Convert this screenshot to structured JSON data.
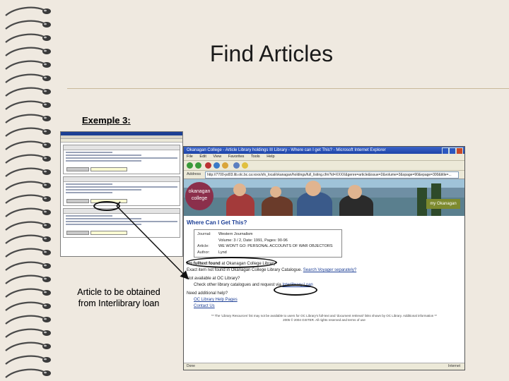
{
  "slide": {
    "title": "Find Articles",
    "example_label": "Exemple 3:",
    "note": "Article to be obtained from Interlibrary loan",
    "colors": {
      "background": "#efe9e0",
      "rule": "#c8b89a",
      "text": "#1a1a1a"
    }
  },
  "browser": {
    "window_title": "Okanagan College - Article Library holdings III Library - Where can I get This? - Microsoft Internet Explorer",
    "menu": [
      "File",
      "Edit",
      "View",
      "Favorites",
      "Tools",
      "Help"
    ],
    "address_label": "Address",
    "url": "http://7700-pd03.lib.olc.bc.ca:xxxx/sfx_local/okanagan/holdings/full_listing.cfm?id=XXXX&genre=article&issue=2&volume=3&spage=90&epage=300&title=...",
    "banner": {
      "logo_line1": "okanagan",
      "logo_line2": "college",
      "my_okanagan": "my Okanagan"
    },
    "page": {
      "heading": "Where Can I Get This?",
      "citation": [
        {
          "key": "Journal:",
          "value": "Western Journalism"
        },
        {
          "key": "",
          "value": "Volume: 3 / 2, Date: 1991, Pages: 90-96"
        },
        {
          "key": "Article:",
          "value": "WE WON'T GO: PERSONAL ACCOUNTS OF WAR OBJECTORS"
        },
        {
          "key": "Author:",
          "value": "Lynd"
        }
      ],
      "no_fulltext_prefix": "No fulltext found",
      "no_fulltext_suffix": " at Okanagan College Library",
      "exact_item_text": "Exact item not found in Okanagan College Library Catalogue.",
      "search_voyager_link": "Search Voyager separately?",
      "not_available_heading": "Not available at OC Library?",
      "check_other_prefix": "Check other library catalogues and request via ",
      "interlibrary_link": "Interlibrary Loan",
      "need_help_heading": "Need additional help?",
      "help_links": [
        "OC Library Help Pages",
        "Contact Us"
      ],
      "footer_line1": "** The 'Library Resources' list may not be available to users for OC Library's full-text and 'document retrieval' links shown by OC Library. Additional information **",
      "footer_line2": "2005 © 2004 GISTER. All rights reserved and terms of use"
    },
    "status_left": "Done",
    "status_right": "Internet"
  },
  "back_screenshot": {
    "description_hidden": false
  }
}
